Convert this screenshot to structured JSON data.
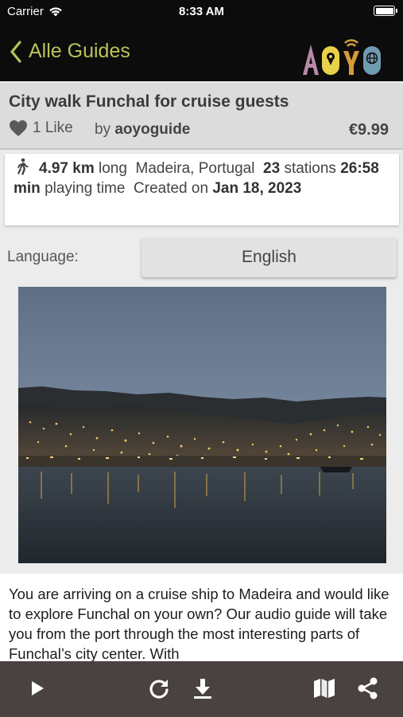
{
  "status_bar": {
    "carrier": "Carrier",
    "time": "8:33 AM"
  },
  "nav": {
    "back_label": "Alle Guides",
    "logo_text": "AOYO"
  },
  "guide": {
    "title": "City walk Funchal for cruise guests",
    "likes": "1 Like",
    "by_prefix": "by",
    "author": "aoyoguide",
    "price": "€9.99"
  },
  "info": {
    "distance": "4.97 km",
    "distance_suffix": "long",
    "location": "Madeira, Portugal",
    "stations": "23",
    "stations_suffix": "stations",
    "duration": "26:58 min",
    "duration_suffix": "playing time",
    "created_prefix": "Created on",
    "created_date": "Jan 18, 2023"
  },
  "language": {
    "label": "Language:",
    "selected": "English"
  },
  "description": "You are arriving on a cruise ship to Madeira and would like to explore Funchal on your own? Our audio guide will take you from the port through the most interesting parts of Funchal’s city center. With",
  "toolbar": {
    "icons": [
      "play-icon",
      "reload-icon",
      "download-icon",
      "map-icon",
      "share-icon"
    ]
  },
  "colors": {
    "accent_green": "#b9c25a",
    "toolbar_bg": "#4a4141",
    "top_bg": "#0d0c0c"
  }
}
